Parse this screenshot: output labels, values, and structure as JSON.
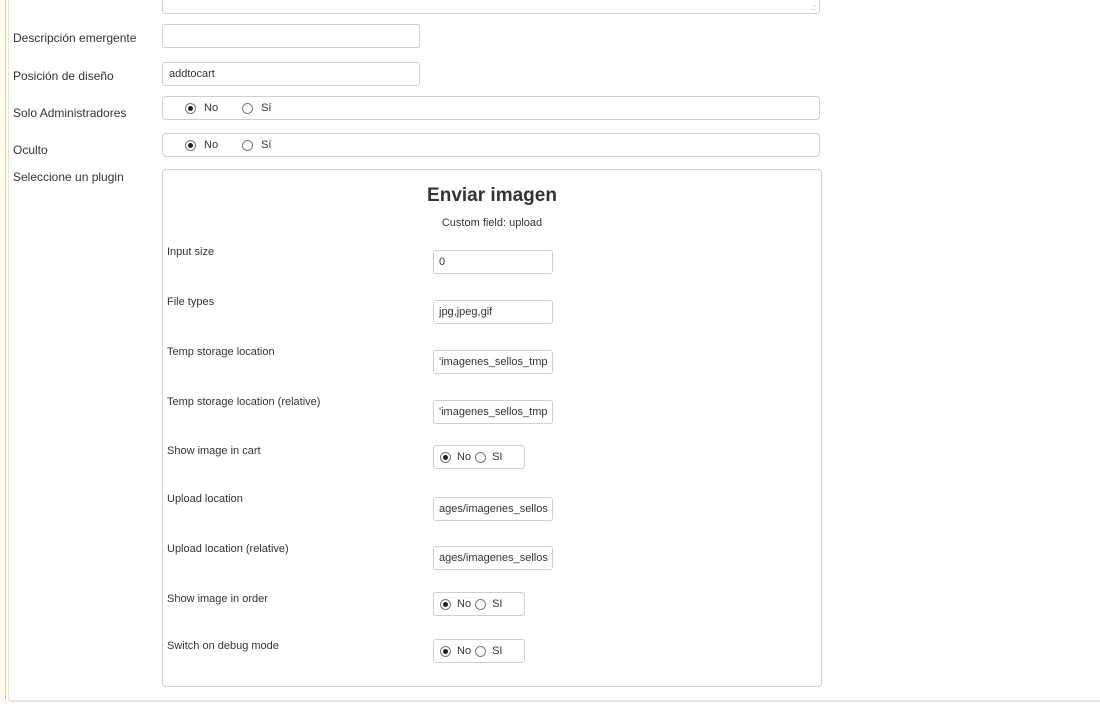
{
  "fields": {
    "descripcion_label": "Descripción emergente",
    "descripcion_value": "",
    "posicion_label": "Posición de diseño",
    "posicion_value": "addtocart",
    "solo_admin_label": "Solo Administradores",
    "oculto_label": "Oculto",
    "plugin_label": "Seleccione un plugin",
    "option_no": "No",
    "option_si": "Sí",
    "solo_admin_selected": "No",
    "oculto_selected": "No"
  },
  "plugin": {
    "title": "Enviar imagen",
    "subtitle": "Custom field: upload",
    "option_no": "No",
    "option_si": "SI",
    "rows": [
      {
        "label": "Input size",
        "type": "input",
        "value": "0"
      },
      {
        "label": "File types",
        "type": "input",
        "value": "jpg,jpeg,gif"
      },
      {
        "label": "Temp storage location",
        "type": "input",
        "value": "'imagenes_sellos_tmp"
      },
      {
        "label": "Temp storage location (relative)",
        "type": "input",
        "value": "'imagenes_sellos_tmp"
      },
      {
        "label": "Show image in cart",
        "type": "radio",
        "selected": "No"
      },
      {
        "label": "Upload location",
        "type": "input",
        "value": "ages/imagenes_sellos"
      },
      {
        "label": "Upload location (relative)",
        "type": "input",
        "value": "ages/imagenes_sellos"
      },
      {
        "label": "Show image in order",
        "type": "radio",
        "selected": "No"
      },
      {
        "label": "Switch on debug mode",
        "type": "radio",
        "selected": "No"
      }
    ]
  }
}
